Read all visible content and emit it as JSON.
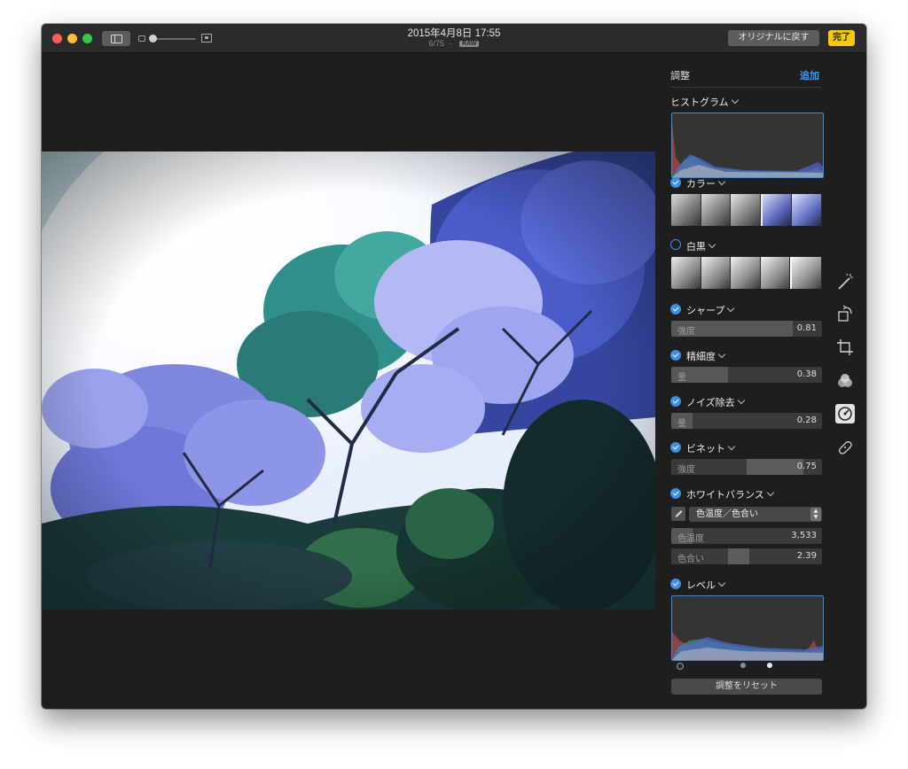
{
  "window": {
    "title_date": "2015年4月8日 17:55",
    "photo_index": "6/75",
    "separator": "·",
    "raw_badge": "RAW",
    "revert_button": "オリジナルに戻す",
    "done_button": "完了"
  },
  "panel": {
    "heading": "調整",
    "add_button": "追加",
    "histogram_label": "ヒストグラム",
    "sections": {
      "color": {
        "label": "カラー",
        "enabled": true
      },
      "bw": {
        "label": "白黒",
        "enabled": false
      },
      "sharpen": {
        "label": "シャープ",
        "enabled": true,
        "slider_label": "強度",
        "value": "0.81"
      },
      "definition": {
        "label": "精細度",
        "enabled": true,
        "slider_label": "量",
        "value": "0.38"
      },
      "noise": {
        "label": "ノイズ除去",
        "enabled": true,
        "slider_label": "量",
        "value": "0.28"
      },
      "vignette": {
        "label": "ビネット",
        "enabled": true,
        "slider_label": "強度",
        "value": "0.75"
      },
      "white_balance": {
        "label": "ホワイトバランス",
        "enabled": true,
        "mode": "色温度／色合い",
        "temperature_label": "色温度",
        "temperature_value": "3,533",
        "tint_label": "色合い",
        "tint_value": "2.39"
      },
      "levels": {
        "label": "レベル",
        "enabled": true
      }
    },
    "reset_button": "調整をリセット"
  },
  "toolbar_icons": [
    "magic-wand-icon",
    "rotate-icon",
    "crop-icon",
    "filters-icon",
    "adjust-icon",
    "retouch-bandage-icon"
  ],
  "colors": {
    "accent_blue": "#3d8ee6",
    "done_yellow": "#f6c90e",
    "window_bg": "#1e1e1e"
  }
}
